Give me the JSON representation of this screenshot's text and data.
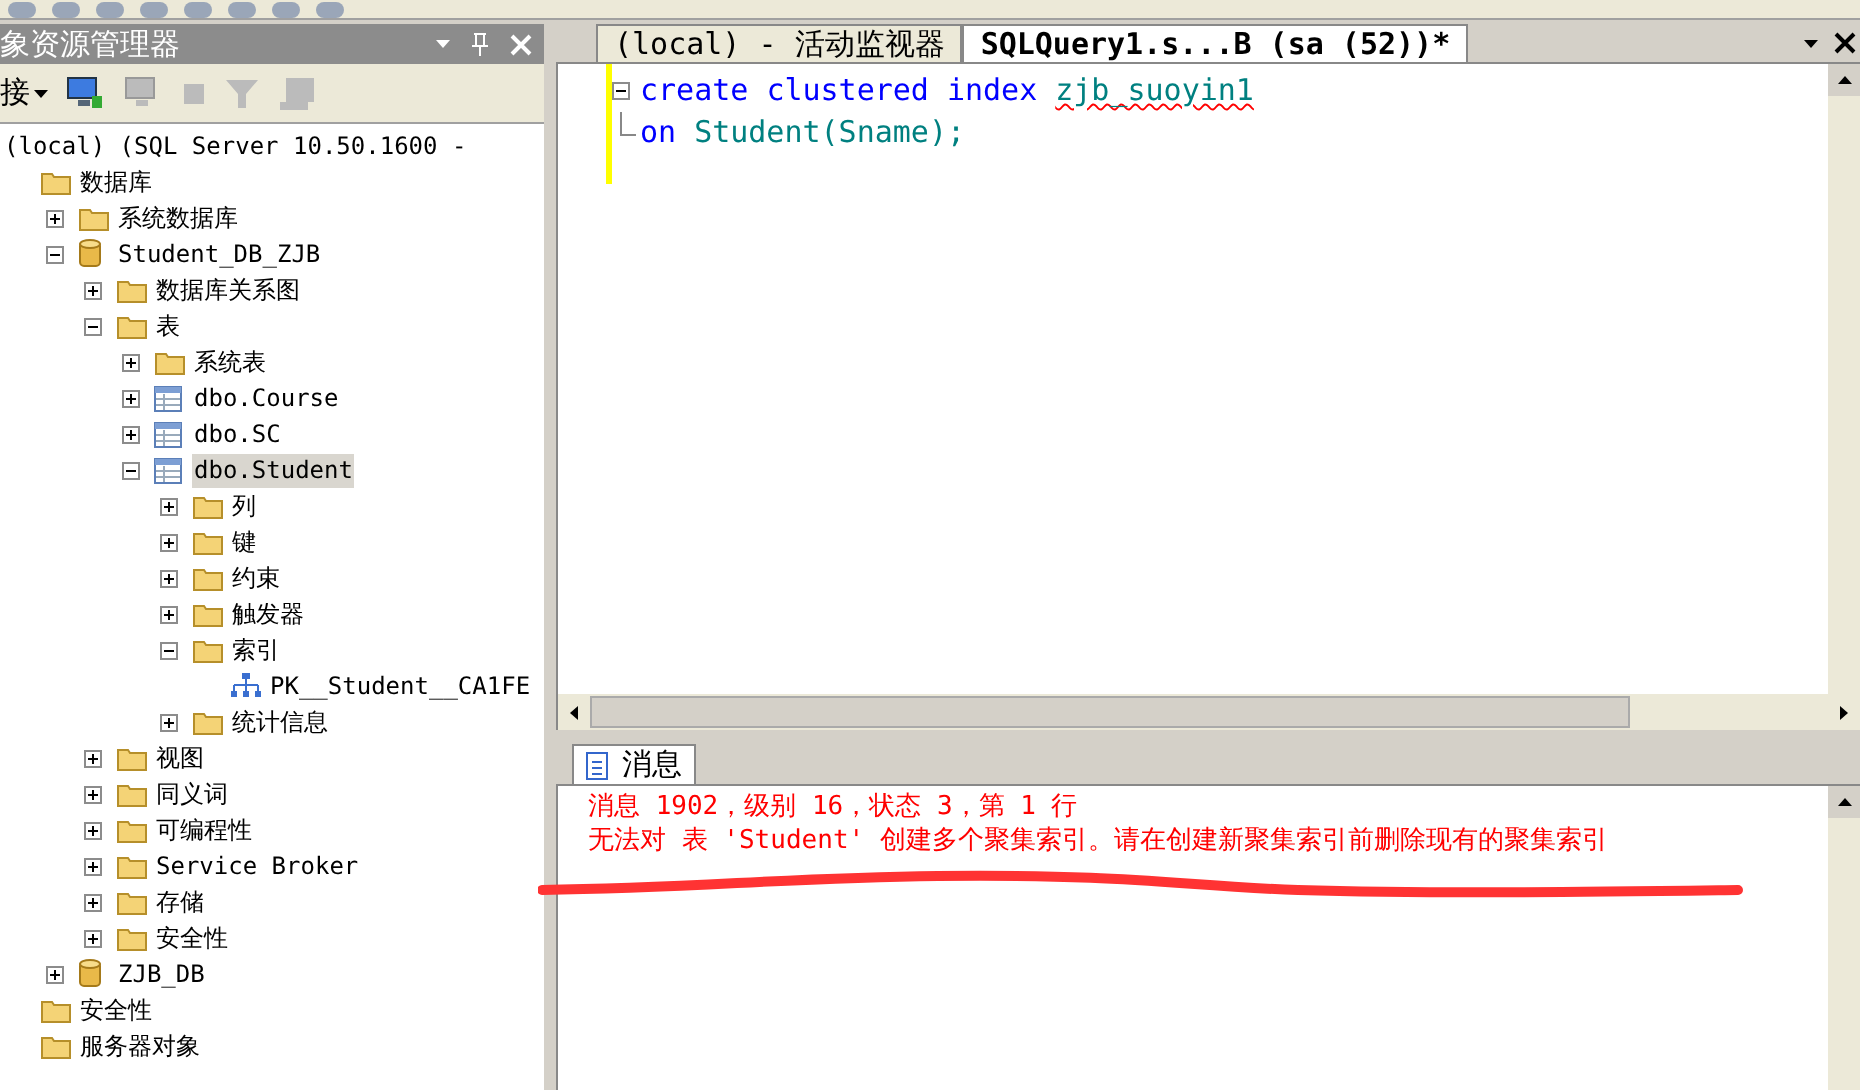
{
  "explorer": {
    "title": "象资源管理器",
    "connect_label": "接",
    "tree": [
      {
        "kind": "server",
        "label": "(local) (SQL Server 10.50.1600 -",
        "children": [
          {
            "kind": "folder",
            "label": "数据库",
            "children": [
              {
                "kind": "folder",
                "label": "系统数据库",
                "expanded": false
              },
              {
                "kind": "database",
                "label": "Student_DB_ZJB",
                "expanded": true,
                "children": [
                  {
                    "kind": "folder",
                    "label": "数据库关系图",
                    "expanded": false
                  },
                  {
                    "kind": "folder",
                    "label": "表",
                    "expanded": true,
                    "children": [
                      {
                        "kind": "folder",
                        "label": "系统表",
                        "expanded": false
                      },
                      {
                        "kind": "table",
                        "label": "dbo.Course",
                        "expanded": false
                      },
                      {
                        "kind": "table",
                        "label": "dbo.SC",
                        "expanded": false
                      },
                      {
                        "kind": "table",
                        "label": "dbo.Student",
                        "expanded": true,
                        "selected": true,
                        "children": [
                          {
                            "kind": "folder",
                            "label": "列",
                            "expanded": false
                          },
                          {
                            "kind": "folder",
                            "label": "键",
                            "expanded": false
                          },
                          {
                            "kind": "folder",
                            "label": "约束",
                            "expanded": false
                          },
                          {
                            "kind": "folder",
                            "label": "触发器",
                            "expanded": false
                          },
                          {
                            "kind": "folder",
                            "label": "索引",
                            "expanded": true,
                            "children": [
                              {
                                "kind": "index",
                                "label": "PK__Student__CA1FE"
                              }
                            ]
                          },
                          {
                            "kind": "folder",
                            "label": "统计信息",
                            "expanded": false
                          }
                        ]
                      }
                    ]
                  },
                  {
                    "kind": "folder",
                    "label": "视图",
                    "expanded": false
                  },
                  {
                    "kind": "folder",
                    "label": "同义词",
                    "expanded": false
                  },
                  {
                    "kind": "folder",
                    "label": "可编程性",
                    "expanded": false
                  },
                  {
                    "kind": "folder",
                    "label": "Service Broker",
                    "expanded": false
                  },
                  {
                    "kind": "folder",
                    "label": "存储",
                    "expanded": false
                  },
                  {
                    "kind": "folder",
                    "label": "安全性",
                    "expanded": false
                  }
                ]
              },
              {
                "kind": "database",
                "label": "ZJB_DB",
                "expanded": false
              }
            ]
          },
          {
            "kind": "folder",
            "label": "安全性"
          },
          {
            "kind": "folder",
            "label": "服务器对象"
          }
        ]
      }
    ]
  },
  "editor_tabs": [
    {
      "label": "(local) - 活动监视器",
      "selected": false
    },
    {
      "label": "SQLQuery1.s...B (sa (52))*",
      "selected": true
    }
  ],
  "code": [
    [
      {
        "kind": "keyword",
        "text": "create"
      },
      {
        "kind": "keyword",
        "text": "clustered"
      },
      {
        "kind": "keyword",
        "text": "index"
      },
      {
        "kind": "identifier",
        "text": "zjb_suoyin1",
        "error": true
      }
    ],
    [
      {
        "kind": "keyword",
        "text": "on"
      },
      {
        "kind": "identifier",
        "text": "Student(Sname);"
      }
    ]
  ],
  "results": {
    "tab": "消息",
    "messages": [
      "消息 1902，级别 16，状态 3，第 1 行",
      "无法对 表 'Student' 创建多个聚集索引。请在创建新聚集索引前删除现有的聚集索引"
    ]
  }
}
